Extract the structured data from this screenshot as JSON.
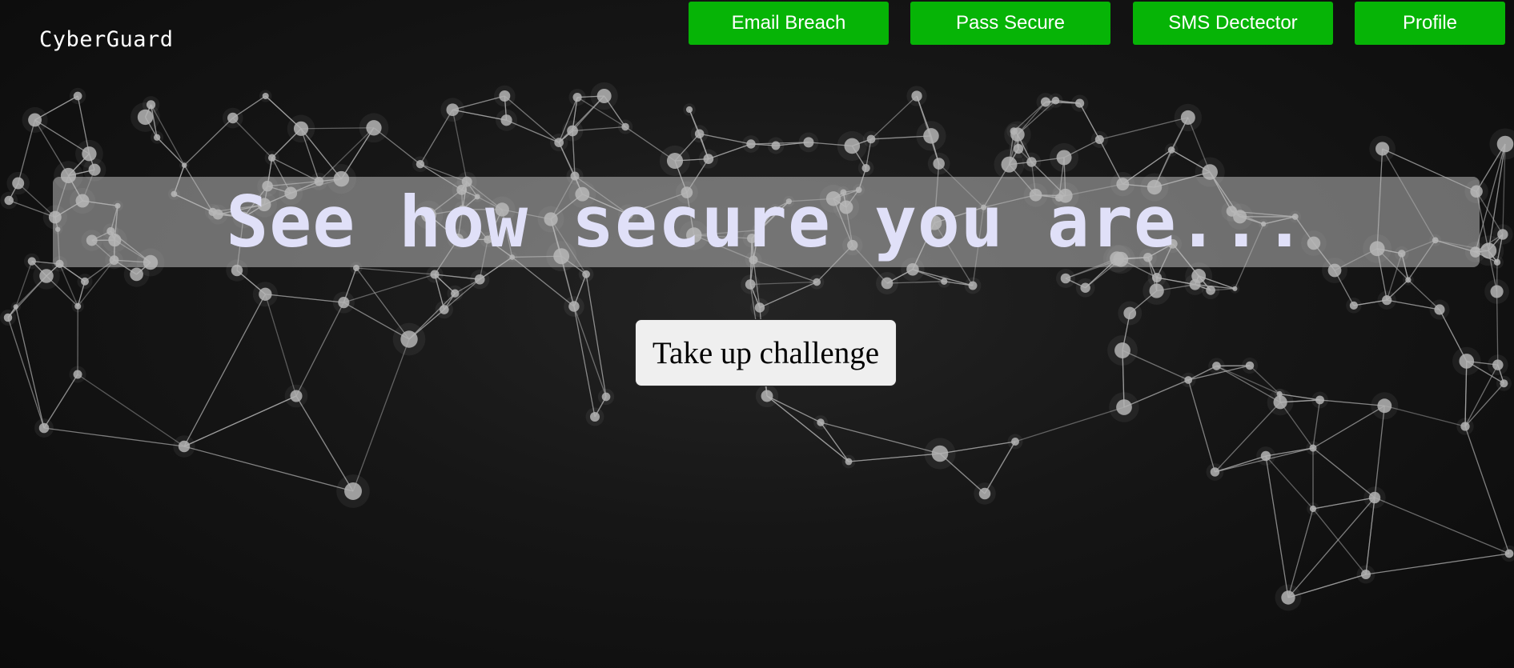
{
  "header": {
    "brand": "CyberGuard",
    "nav": [
      {
        "label": "Email Breach"
      },
      {
        "label": "Pass Secure"
      },
      {
        "label": "SMS Dectector"
      },
      {
        "label": "Profile"
      }
    ],
    "nav_color": "#06b406"
  },
  "hero": {
    "title": "See how secure you are...",
    "cta_label": "Take up challenge"
  },
  "background": {
    "description_icon": "network-graph",
    "node_color": "#b4b4b4",
    "line_color": "#aaaaaa"
  }
}
